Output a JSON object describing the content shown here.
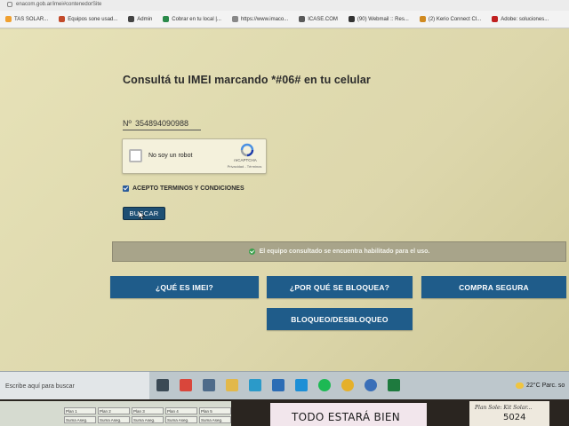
{
  "browser": {
    "url": "enacom.gob.ar/imei#contenedorSite",
    "bookmarks": [
      {
        "label": "TAS SOLAR...",
        "color": "#f0a030"
      },
      {
        "label": "Equipos sone usad...",
        "color": "#c24a2a"
      },
      {
        "label": "Admin",
        "color": "#444444"
      },
      {
        "label": "Cobrar en tu local |...",
        "color": "#2a8a4a"
      },
      {
        "label": "https://www.imaco...",
        "color": "#888888"
      },
      {
        "label": "ICASE.COM",
        "color": "#5a5a5a"
      },
      {
        "label": "(90) Webmail :: Res...",
        "color": "#333333"
      },
      {
        "label": "(2) Kerio Connect Cl...",
        "color": "#d08a20"
      },
      {
        "label": "Adobe: soluciones...",
        "color": "#c02020"
      }
    ]
  },
  "page": {
    "title": "Consultá tu IMEI marcando *#06# en tu celular",
    "imei_prefix": "Nº",
    "imei_value": "354894090988",
    "captcha": {
      "label": "No soy un robot",
      "brand": "reCAPTCHA",
      "links": "Privacidad - Términos"
    },
    "terms_label": "ACEPTO TERMINOS Y CONDICIONES",
    "terms_checked": true,
    "search_button": "BUSCAR",
    "result_message": "El equipo consultado se encuentra habilitado para el uso.",
    "result_color": "#3aa04c",
    "buttons": {
      "what_is_imei": "¿QUÉ ES IMEI?",
      "why_blocked": "¿POR QUÉ SE BLOQUEA?",
      "safe_purchase": "COMPRA SEGURA",
      "block_unblock": "BLOQUEO/DESBLOQUEO"
    },
    "accent_color": "#1f5c8a"
  },
  "taskbar": {
    "search_placeholder": "Escribe aquí para buscar",
    "weather": "22°C  Parc. so"
  },
  "desk": {
    "sticky_text": "TODO ESTARÁ BIEN",
    "note_text": "Plan Sole: Kit Solar...",
    "note_number": "5024",
    "sheet_headers": [
      "Plan 1",
      "Plan 2",
      "Plan 3",
      "Plan 4",
      "Plan 5"
    ],
    "sheet_row": [
      "Suma Aseg.",
      "Suma Aseg.",
      "Suma Aseg.",
      "Suma Aseg.",
      "Suma Aseg."
    ]
  }
}
